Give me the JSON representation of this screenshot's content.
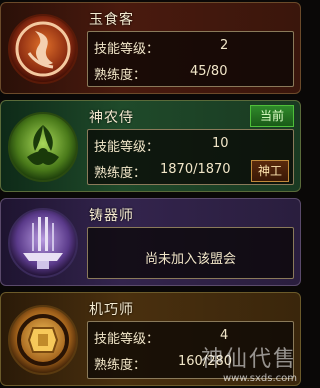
{
  "professions": [
    {
      "name": "玉食客",
      "skill_level_label": "技能等级：",
      "skill_level": "2",
      "proficiency_label": "熟练度：",
      "proficiency": "45/80",
      "icon": "dragon-emblem-icon",
      "color": "#c0502a"
    },
    {
      "name": "神农侍",
      "skill_level_label": "技能等级：",
      "skill_level": "10",
      "proficiency_label": "熟练度：",
      "proficiency": "1870/1870",
      "current_label": "当前",
      "action_label": "神工",
      "icon": "leaf-emblem-icon",
      "color": "#6aa83a"
    },
    {
      "name": "铸器师",
      "status": "尚未加入该盟会",
      "icon": "anvil-swords-icon",
      "color": "#8a6ac0"
    },
    {
      "name": "机巧师",
      "skill_level_label": "技能等级：",
      "skill_level": "4",
      "proficiency_label": "熟练度：",
      "proficiency": "160/280",
      "icon": "gear-puzzle-icon",
      "color": "#e0a02a"
    }
  ],
  "watermark": {
    "title": "神仙代售",
    "url": "www.sxds.com"
  }
}
